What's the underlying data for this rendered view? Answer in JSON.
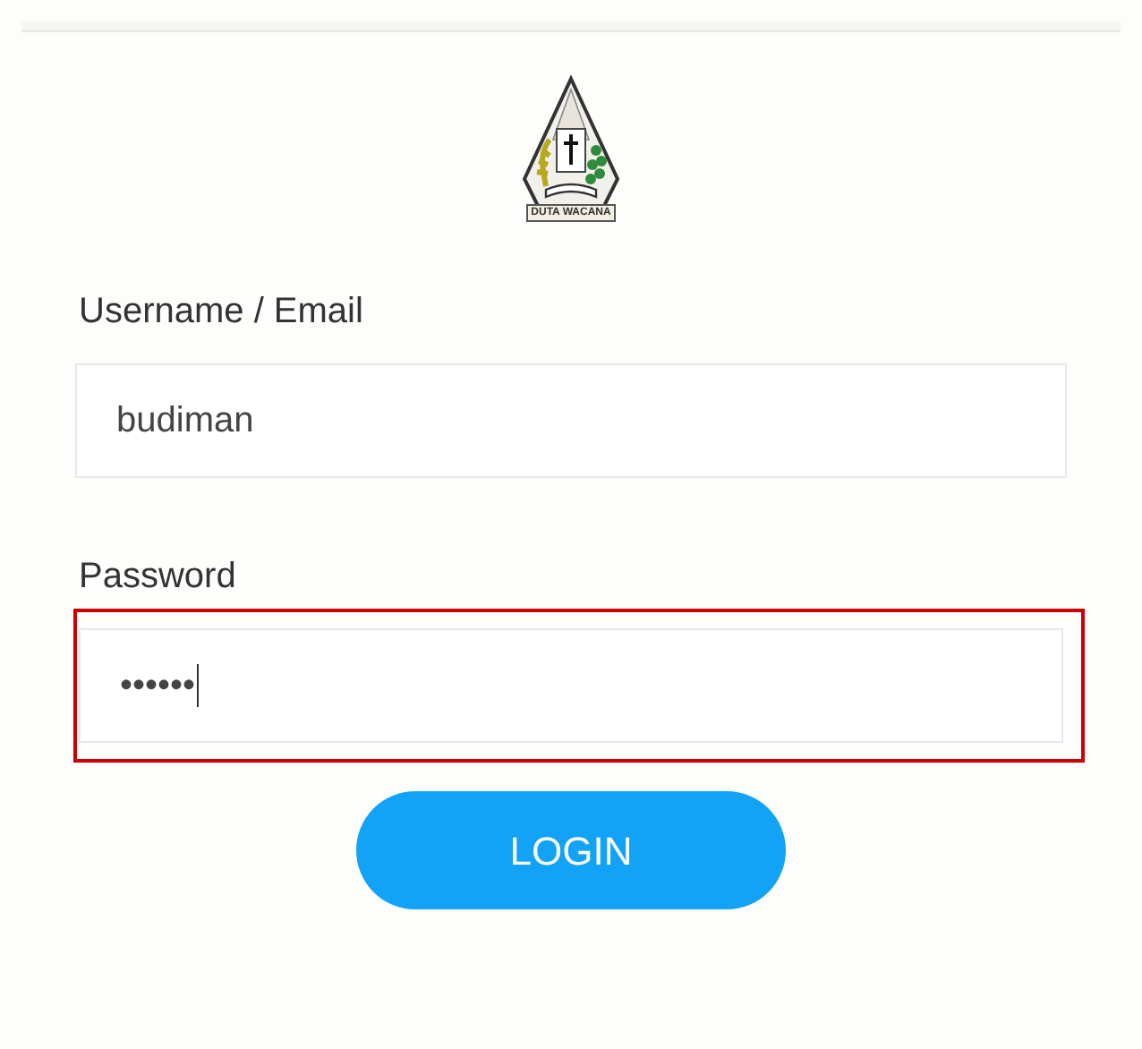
{
  "logo": {
    "banner": "DUTA WACANA"
  },
  "fields": [
    {
      "label": "Username / Email",
      "value": "budiman",
      "highlighted": false,
      "caret": false
    },
    {
      "label": "Password",
      "value": "••••••",
      "highlighted": true,
      "caret": true
    }
  ],
  "button": "LOGIN"
}
